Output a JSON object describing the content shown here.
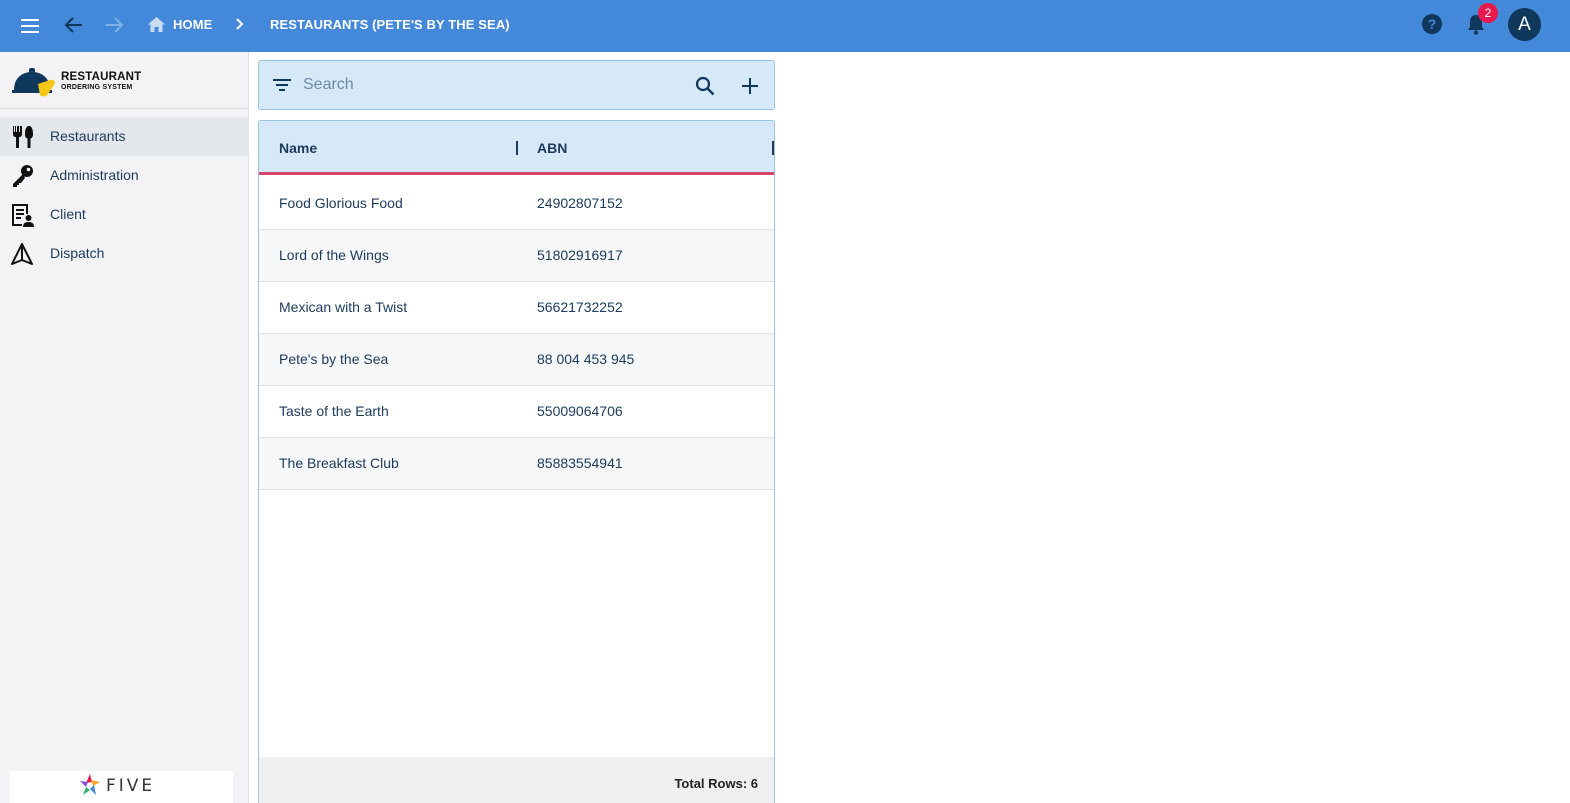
{
  "topbar": {
    "breadcrumb_home": "HOME",
    "breadcrumb_current": "RESTAURANTS (PETE'S BY THE SEA)",
    "notification_count": "2",
    "avatar_initial": "A"
  },
  "sidebar": {
    "logo_title": "RESTAURANT",
    "logo_subtitle": "ORDERING SYSTEM",
    "items": [
      {
        "label": "Restaurants",
        "icon": "cutlery-icon",
        "active": true
      },
      {
        "label": "Administration",
        "icon": "key-icon",
        "active": false
      },
      {
        "label": "Client",
        "icon": "client-list-icon",
        "active": false
      },
      {
        "label": "Dispatch",
        "icon": "dispatch-icon",
        "active": false
      }
    ],
    "footer_brand": "FIVE"
  },
  "search": {
    "placeholder": "Search"
  },
  "table": {
    "columns": [
      "Name",
      "ABN"
    ],
    "rows": [
      [
        "Food Glorious Food",
        "24902807152"
      ],
      [
        "Lord of the Wings",
        "51802916917"
      ],
      [
        "Mexican with a Twist",
        "56621732252"
      ],
      [
        "Pete's by the Sea",
        "88 004 453 945"
      ],
      [
        "Taste of the Earth",
        "55009064706"
      ],
      [
        "The Breakfast Club",
        "85883554941"
      ]
    ],
    "total_rows": "Total Rows: 6"
  },
  "colors": {
    "topbar": "#4488d9",
    "accent_underline": "#d9466a",
    "header_bg": "#d5e9f8",
    "text": "#1c3a5c",
    "badge": "#e8194e",
    "avatar": "#10375c"
  }
}
